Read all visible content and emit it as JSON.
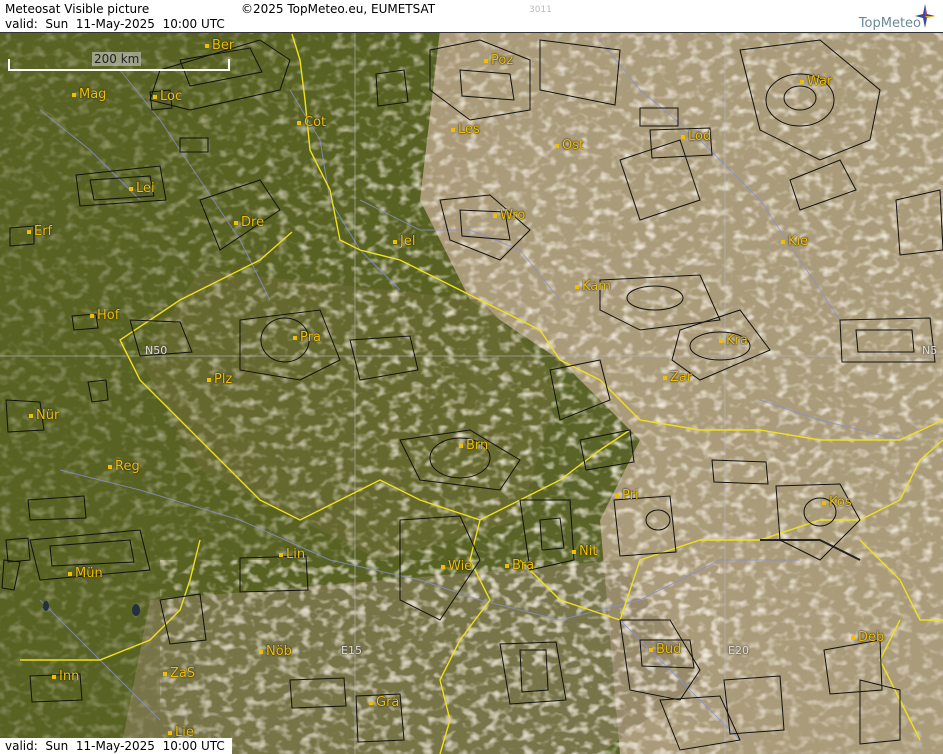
{
  "header": {
    "title": "Meteosat Visible picture",
    "copyright": "©2025 TopMeteo.eu, EUMETSAT",
    "valid_top": "valid:  Sun  11-May-2025  10:00 UTC",
    "image_id": "3011",
    "logo": "TopMeteo"
  },
  "footer": {
    "valid_bottom": "valid:  Sun  11-May-2025  10:00 UTC"
  },
  "scale": {
    "label": "200 km"
  },
  "grid_labels": {
    "n50_left": "N50",
    "n50_right": "N5",
    "e15": "E15",
    "e20": "E20"
  },
  "cities": [
    {
      "key": "ber",
      "name": "Ber"
    },
    {
      "key": "poz",
      "name": "Poz"
    },
    {
      "key": "war",
      "name": "War"
    },
    {
      "key": "mag",
      "name": "Mag"
    },
    {
      "key": "loc",
      "name": "Loc"
    },
    {
      "key": "cot",
      "name": "Cot"
    },
    {
      "key": "les",
      "name": "Les"
    },
    {
      "key": "ost",
      "name": "Ost"
    },
    {
      "key": "lod",
      "name": "Lod"
    },
    {
      "key": "lei",
      "name": "Lei"
    },
    {
      "key": "dre",
      "name": "Dre"
    },
    {
      "key": "wro",
      "name": "Wro"
    },
    {
      "key": "erf",
      "name": "Erf"
    },
    {
      "key": "jel",
      "name": "Jel"
    },
    {
      "key": "kie",
      "name": "Kie"
    },
    {
      "key": "kam",
      "name": "Kam"
    },
    {
      "key": "hof",
      "name": "Hof"
    },
    {
      "key": "pra",
      "name": "Pra"
    },
    {
      "key": "kra",
      "name": "Kra"
    },
    {
      "key": "plz",
      "name": "Plz"
    },
    {
      "key": "zar",
      "name": "Zar"
    },
    {
      "key": "nur",
      "name": "Nür"
    },
    {
      "key": "brn",
      "name": "Brn"
    },
    {
      "key": "reg",
      "name": "Reg"
    },
    {
      "key": "pri",
      "name": "Pri"
    },
    {
      "key": "kos",
      "name": "Kos"
    },
    {
      "key": "lin",
      "name": "Lin"
    },
    {
      "key": "nit",
      "name": "Nit"
    },
    {
      "key": "wie",
      "name": "Wie"
    },
    {
      "key": "bra",
      "name": "Bra"
    },
    {
      "key": "mun",
      "name": "Mün"
    },
    {
      "key": "nob",
      "name": "Nöb"
    },
    {
      "key": "bud",
      "name": "Bud"
    },
    {
      "key": "deb",
      "name": "Deb"
    },
    {
      "key": "zas",
      "name": "ZaS"
    },
    {
      "key": "inn",
      "name": "Inn"
    },
    {
      "key": "gra",
      "name": "Gra"
    },
    {
      "key": "lie",
      "name": "Lie"
    }
  ],
  "colors": {
    "land_green": "#5f6a2a",
    "cloud": "#e8dcc8",
    "border": "#f0e020",
    "river": "#8890d0",
    "city": "#f0c000"
  }
}
